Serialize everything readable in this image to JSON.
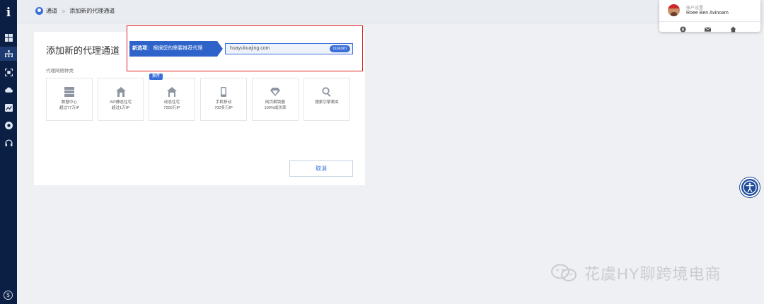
{
  "sidebar": {
    "logo": "i",
    "bottom_icon": "dollar-circle-icon",
    "items": [
      {
        "icon": "dashboard-icon"
      },
      {
        "icon": "network-icon",
        "active": true
      },
      {
        "icon": "scan-icon"
      },
      {
        "icon": "cloud-icon"
      },
      {
        "icon": "chart-icon"
      },
      {
        "icon": "chrome-icon"
      },
      {
        "icon": "headset-icon"
      }
    ]
  },
  "breadcrumb": {
    "root": "通道",
    "separator": ">",
    "current": "添加新的代理通道"
  },
  "page": {
    "title": "添加新的代理通道",
    "section_label": "代理网络种类",
    "tiles": [
      {
        "icon": "server-icon",
        "line1": "数据中心",
        "line2": "超过77万IP"
      },
      {
        "icon": "house-icon",
        "line1": "ISP静态住宅",
        "line2": "超过1万IP"
      },
      {
        "icon": "house-icon",
        "line1": "动态住宅",
        "line2": "7200万IP",
        "badge": "推荐"
      },
      {
        "icon": "mobile-icon",
        "line1": "手机移动",
        "line2": "700多万IP"
      },
      {
        "icon": "diamond-icon",
        "line1": "网页解锁器",
        "line2": "100%成功率"
      },
      {
        "icon": "search-icon",
        "line1": "搜索引擎爬虫",
        "line2": ""
      }
    ],
    "cancel_label": "取消"
  },
  "highlight": {
    "banner_prefix": "新选项:",
    "banner_text": "根据您的需要推荐代理",
    "url_value": "huayukuajing.com",
    "url_chip": "custom",
    "border_color": "#e02424"
  },
  "account": {
    "label": "账户设置",
    "name": "Roee Ben Avinoam",
    "actions": [
      "skype-icon",
      "mail-icon",
      "home-icon"
    ]
  },
  "watermark": {
    "text": "花虞HY聊跨境电商"
  },
  "colors": {
    "sidebar": "#0b1f44",
    "accent": "#3a6fd8"
  }
}
